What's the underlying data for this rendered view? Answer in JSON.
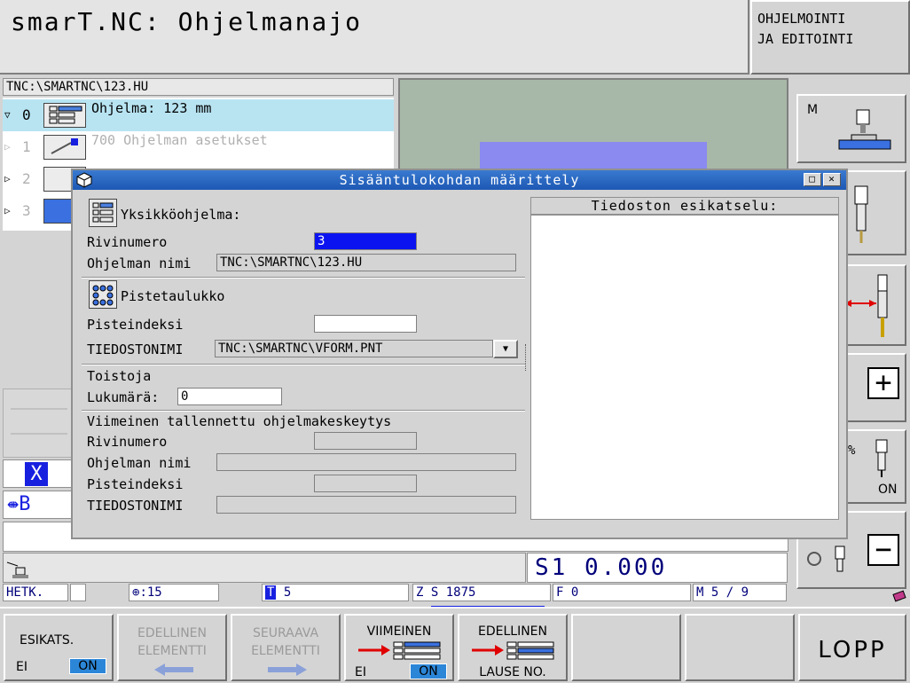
{
  "header": {
    "title": "smarT.NC: Ohjelmanajo",
    "mode_line1": "OHJELMOINTI",
    "mode_line2": "JA EDITOINTI"
  },
  "tree": {
    "path": "TNC:\\SMARTNC\\123.HU",
    "rows": [
      {
        "num": "0",
        "label": "Ohjelma: 123 mm"
      },
      {
        "num": "1",
        "label": "700 Ohjelman asetukset"
      },
      {
        "num": "2",
        "label": ""
      },
      {
        "num": "3",
        "label": ""
      }
    ]
  },
  "dialog": {
    "title": "Sisääntulokohdan määrittely",
    "section1_title": "Yksikköohjelma:",
    "row_number_label": "Rivinumero",
    "row_number_value": "3",
    "program_name_label": "Ohjelman nimi",
    "program_name_value": "TNC:\\SMARTNC\\123.HU",
    "section2_title": "Pistetaulukko",
    "point_index_label": "Pisteindeksi",
    "point_index_value": "",
    "filename_label": "TIEDOSTONIMI",
    "filename_value": "TNC:\\SMARTNC\\VFORM.PNT",
    "repeat_title": "Toistoja",
    "count_label": "Lukumärä:",
    "count_value": "0",
    "last_saved_title": "Viimeinen tallennettu ohjelmakeskeytys",
    "last_row_label": "Rivinumero",
    "last_program_label": "Ohjelman nimi",
    "last_point_label": "Pisteindeksi",
    "last_file_label": "TIEDOSTONIMI",
    "preview_title": "Tiedoston esikatselu:"
  },
  "axes": {
    "x": "X",
    "b": "B"
  },
  "s1": "S1   0.000",
  "status": {
    "mode": "HETK.",
    "feed_override": ":15",
    "tool_letter": "T",
    "tool_value": "5",
    "z_letter": "Z",
    "spindle": "S 1875",
    "feed": "F  0",
    "m_func": "M  5 / 9"
  },
  "side": {
    "m_label": "M",
    "percent": "%",
    "on": "ON",
    "plus": "+",
    "minus": "−"
  },
  "softkeys": {
    "preview_label": "ESIKATS.",
    "preview_off": "EI",
    "preview_on": "ON",
    "prev_element_1": "EDELLINEN",
    "prev_element_2": "ELEMENTTI",
    "next_element_1": "SEURAAVA",
    "next_element_2": "ELEMENTTI",
    "last_label": "VIIMEINEN",
    "last_off": "EI",
    "last_on": "ON",
    "prev_block_1": "EDELLINEN",
    "prev_block_2": "LAUSE NO.",
    "end": "LOPP"
  }
}
